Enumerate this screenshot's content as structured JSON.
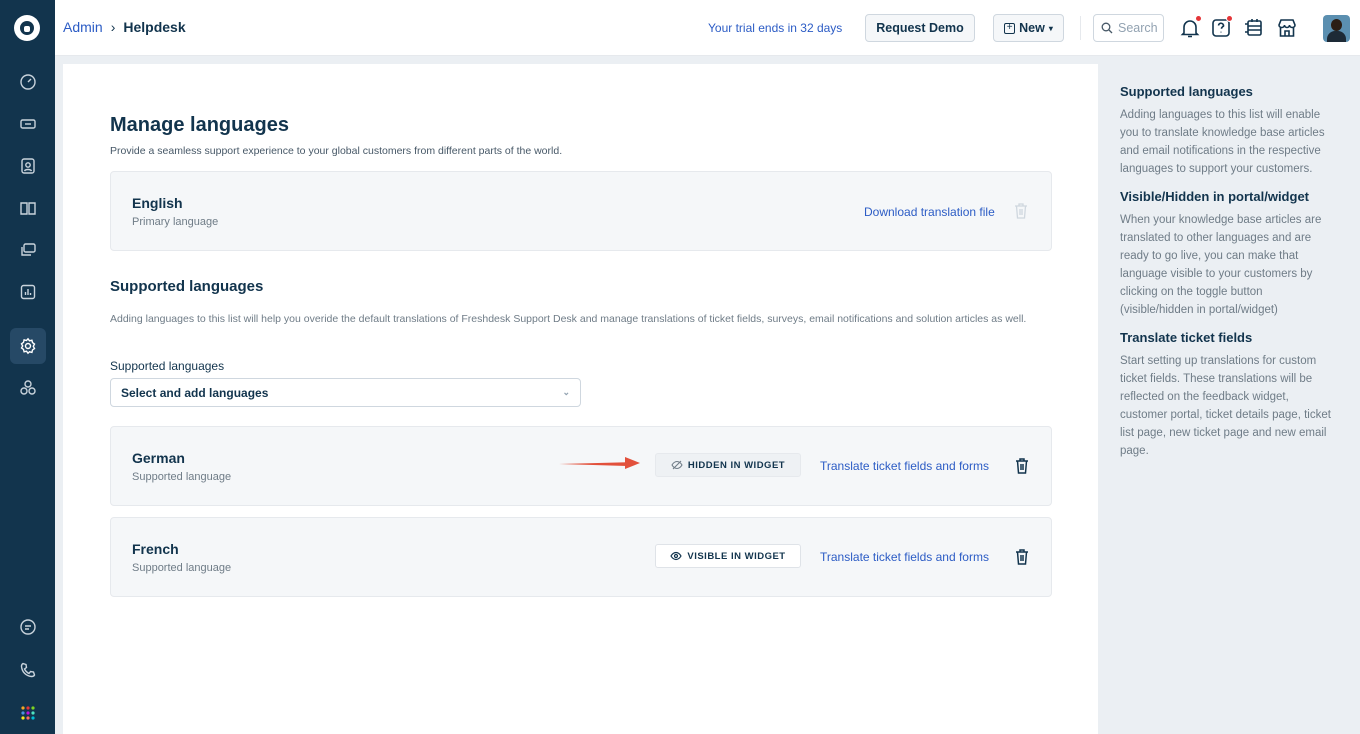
{
  "header": {
    "breadcrumb_parent": "Admin",
    "breadcrumb_separator": "›",
    "breadcrumb_current": "Helpdesk",
    "trial_text": "Your trial ends in 32 days",
    "request_demo_label": "Request Demo",
    "new_label": "New",
    "search_placeholder": "Search"
  },
  "sidebar": {
    "icons": [
      "dashboard-icon",
      "tickets-icon",
      "contacts-icon",
      "solutions-icon",
      "forums-icon",
      "reports-icon",
      "admin-settings-icon",
      "groups-icon",
      "chat-icon",
      "phone-icon",
      "apps-grid-icon"
    ],
    "active": "admin-settings-icon"
  },
  "main": {
    "title": "Manage languages",
    "subtitle": "Provide a seamless support experience to your global customers from different parts of the world.",
    "primary": {
      "name": "English",
      "type": "Primary language",
      "download_link": "Download translation file"
    },
    "supported_section": {
      "title": "Supported languages",
      "description": "Adding languages to this list will help you overide the default translations of Freshdesk Support Desk and manage translations of ticket fields, surveys, email notifications and solution articles as well.",
      "field_label": "Supported languages",
      "select_placeholder": "Select and add languages"
    },
    "languages": [
      {
        "name": "German",
        "type": "Supported language",
        "visibility_label": "HIDDEN IN WIDGET",
        "translate_link": "Translate ticket fields and forms"
      },
      {
        "name": "French",
        "type": "Supported language",
        "visibility_label": "VISIBLE IN WIDGET",
        "translate_link": "Translate ticket fields and forms"
      }
    ]
  },
  "help_panel": {
    "sections": [
      {
        "title": "Supported languages",
        "body": "Adding languages to this list will enable you to translate knowledge base articles and email notifications in the respective languages to support your customers."
      },
      {
        "title": "Visible/Hidden in portal/widget",
        "body": "When your knowledge base articles are translated to other languages and are ready to go live, you can make that language visible to your customers by clicking on the toggle button (visible/hidden in portal/widget)"
      },
      {
        "title": "Translate ticket fields",
        "body": "Start setting up translations for custom ticket fields. These translations will be reflected on the feedback widget, customer portal, ticket details page, ticket list page, new ticket page and new email page."
      }
    ]
  },
  "colors": {
    "sidebar_bg": "#12344d",
    "link": "#2c5cc5",
    "annotation_arrow": "#e2513c"
  }
}
